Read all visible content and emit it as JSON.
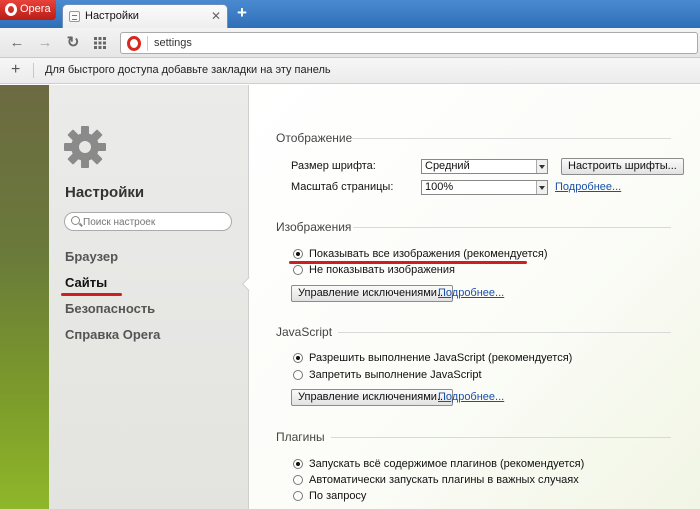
{
  "browser": {
    "menu_label": "Opera",
    "tab_title": "Настройки",
    "tab_close": "✕",
    "new_tab": "+",
    "address": "settings",
    "bookmarks_hint": "Для быстрого доступа добавьте закладки на эту панель",
    "add_bookmark": "+"
  },
  "sidebar": {
    "title": "Настройки",
    "search_placeholder": "Поиск настроек",
    "items": [
      {
        "label": "Браузер",
        "active": false
      },
      {
        "label": "Сайты",
        "active": true
      },
      {
        "label": "Безопасность",
        "active": false
      },
      {
        "label": "Справка Opera",
        "active": false
      }
    ]
  },
  "display": {
    "title": "Отображение",
    "font_size_label": "Размер шрифта:",
    "font_size_value": "Средний",
    "configure_fonts": "Настроить шрифты...",
    "zoom_label": "Масштаб страницы:",
    "zoom_value": "100%",
    "more": "Подробнее..."
  },
  "images": {
    "title": "Изображения",
    "options": [
      "Показывать все изображения (рекомендуется)",
      "Не показывать изображения"
    ],
    "selected": 0,
    "manage": "Управление исключениями...",
    "more": "Подробнее..."
  },
  "javascript": {
    "title": "JavaScript",
    "options": [
      "Разрешить выполнение JavaScript (рекомендуется)",
      "Запретить выполнение JavaScript"
    ],
    "selected": 0,
    "manage": "Управление исключениями...",
    "more": "Подробнее..."
  },
  "plugins": {
    "title": "Плагины",
    "options": [
      "Запускать всё содержимое плагинов (рекомендуется)",
      "Автоматически запускать плагины в важных случаях",
      "По запросу"
    ],
    "selected": 0
  },
  "colors": {
    "accent_red": "#cc1f1f",
    "link": "#1a4fa8",
    "tab_strip": "#3b7cc4"
  }
}
